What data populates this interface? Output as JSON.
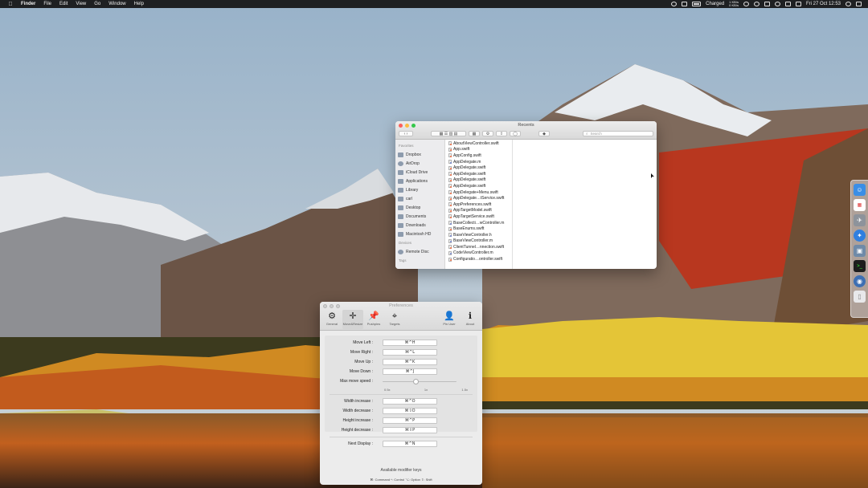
{
  "menubar": {
    "apple_glyph": "",
    "app_name": "Finder",
    "items": [
      "File",
      "Edit",
      "View",
      "Go",
      "Window",
      "Help"
    ],
    "battery_text": "Charged",
    "net_up": "1 KB/s",
    "net_down": "0 KB/s",
    "clock": "Fri 27 Oct  12:53"
  },
  "finder": {
    "title": "Recents",
    "search_placeholder": "Search",
    "sidebar": {
      "favorites_header": "Favorites",
      "favorites": [
        {
          "label": "Dropbox",
          "icon": "dropbox-icon"
        },
        {
          "label": "AirDrop",
          "icon": "airdrop-icon"
        },
        {
          "label": "iCloud Drive",
          "icon": "cloud-icon"
        },
        {
          "label": "Applications",
          "icon": "applications-icon"
        },
        {
          "label": "Library",
          "icon": "folder-icon"
        },
        {
          "label": "carl",
          "icon": "home-icon"
        },
        {
          "label": "Desktop",
          "icon": "desktop-icon"
        },
        {
          "label": "Documents",
          "icon": "documents-icon"
        },
        {
          "label": "Downloads",
          "icon": "downloads-icon"
        },
        {
          "label": "Macintosh HD",
          "icon": "disk-icon"
        }
      ],
      "devices_header": "Devices",
      "devices": [
        {
          "label": "Remote Disc",
          "icon": "disc-icon"
        }
      ],
      "tags_header": "Tags"
    },
    "files": [
      {
        "name": "AboutViewController.swift",
        "type": "swift"
      },
      {
        "name": "App.swift",
        "type": "swift"
      },
      {
        "name": "AppConfig.swift",
        "type": "swift"
      },
      {
        "name": "AppDelegate.m",
        "type": "objc"
      },
      {
        "name": "AppDelegate.swift",
        "type": "swift"
      },
      {
        "name": "AppDelegate.swift",
        "type": "swift"
      },
      {
        "name": "AppDelegate.swift",
        "type": "swift"
      },
      {
        "name": "AppDelegate.swift",
        "type": "swift"
      },
      {
        "name": "AppDelegate+Menu.swift",
        "type": "swift"
      },
      {
        "name": "AppDelegate…tService.swift",
        "type": "swift"
      },
      {
        "name": "AppPreferences.swift",
        "type": "swift"
      },
      {
        "name": "AppTargetModel.swift",
        "type": "swift"
      },
      {
        "name": "AppTargetService.swift",
        "type": "swift"
      },
      {
        "name": "BaseCollecti…wController.m",
        "type": "objc"
      },
      {
        "name": "BaseEnums.swift",
        "type": "swift"
      },
      {
        "name": "BaseViewController.h",
        "type": "objc"
      },
      {
        "name": "BaseViewController.m",
        "type": "objc"
      },
      {
        "name": "ClientTunnel…nnection.swift",
        "type": "swift"
      },
      {
        "name": "CodeViewController.m",
        "type": "objc"
      },
      {
        "name": "Configuratio…ontroller.swift",
        "type": "swift"
      }
    ]
  },
  "prefs": {
    "title": "Preferences",
    "tabs": [
      {
        "label": "General",
        "glyph": "⚙",
        "icon": "gear-icon",
        "selected": false
      },
      {
        "label": "Move&Resize",
        "glyph": "✛",
        "icon": "move-icon",
        "selected": true
      },
      {
        "label": "Pushpins",
        "glyph": "📌",
        "icon": "pushpin-icon",
        "selected": false
      },
      {
        "label": "Targets",
        "glyph": "⌖",
        "icon": "target-icon",
        "selected": false
      }
    ],
    "right_tabs": [
      {
        "label": "Pin User",
        "glyph": "👤",
        "icon": "user-icon"
      },
      {
        "label": "About",
        "glyph": "ℹ",
        "icon": "info-icon"
      }
    ],
    "move_shortcuts": [
      {
        "label": "Move Left :",
        "key": "⌘^H"
      },
      {
        "label": "Move Right :",
        "key": "⌘^L"
      },
      {
        "label": "Move Up :",
        "key": "⌘^K"
      },
      {
        "label": "Move Down :",
        "key": "⌘^J"
      }
    ],
    "speed": {
      "label": "Max move speed :",
      "min_label": "0.5x",
      "mid_label": "1x",
      "max_label": "1.5x",
      "value_fraction": 0.45
    },
    "resize_shortcuts": [
      {
        "label": "Width increase :",
        "key": "⌘^O"
      },
      {
        "label": "Width decrease :",
        "key": "⌘⇧O"
      },
      {
        "label": "Height increase :",
        "key": "⌘^P"
      },
      {
        "label": "Height decrease :",
        "key": "⌘⇧P"
      }
    ],
    "next_display": {
      "label": "Next Display :",
      "key": "⌘^N"
    },
    "footer_title": "Available modifier keys",
    "footer_keys": "⌘: Command  ^: Control  ⌥: Option  ⇧: Shift"
  },
  "colors": {
    "accent": "#5f8fd6",
    "traffic_red": "#fc605c",
    "traffic_yellow": "#fdbc40",
    "traffic_green": "#34c84a"
  }
}
